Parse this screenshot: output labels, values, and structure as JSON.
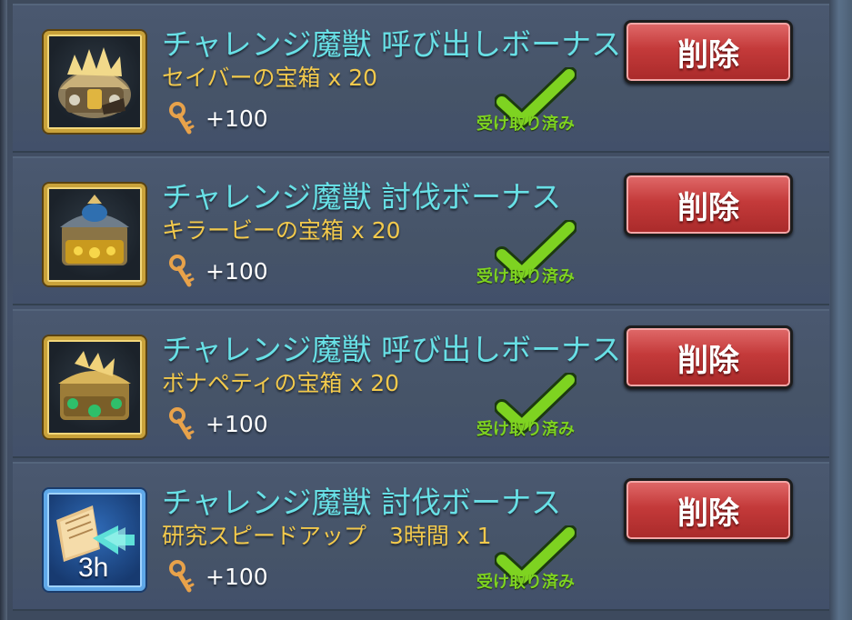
{
  "rows": [
    {
      "title": "チャレンジ魔獣 呼び出しボーナス",
      "item": "セイバーの宝箱 x 20",
      "reward": "+100",
      "status": "受け取り済み",
      "delete_label": "削除",
      "icon": "saber-chest-icon"
    },
    {
      "title": "チャレンジ魔獣 討伐ボーナス",
      "item": "キラービーの宝箱 x 20",
      "reward": "+100",
      "status": "受け取り済み",
      "delete_label": "削除",
      "icon": "killer-bee-chest-icon"
    },
    {
      "title": "チャレンジ魔獣 呼び出しボーナス",
      "item": "ボナペティの宝箱 x 20",
      "reward": "+100",
      "status": "受け取り済み",
      "delete_label": "削除",
      "icon": "bon-appetit-chest-icon"
    },
    {
      "title": "チャレンジ魔獣 討伐ボーナス",
      "item": "研究スピードアップ　3時間 x 1",
      "reward": "+100",
      "status": "受け取り済み",
      "delete_label": "削除",
      "icon": "research-speedup-icon",
      "icon_text": "3h"
    }
  ],
  "colors": {
    "title": "#68e0e6",
    "item": "#f2c94c",
    "claimed": "#7ed321",
    "delete_button": "#c43a3a"
  }
}
